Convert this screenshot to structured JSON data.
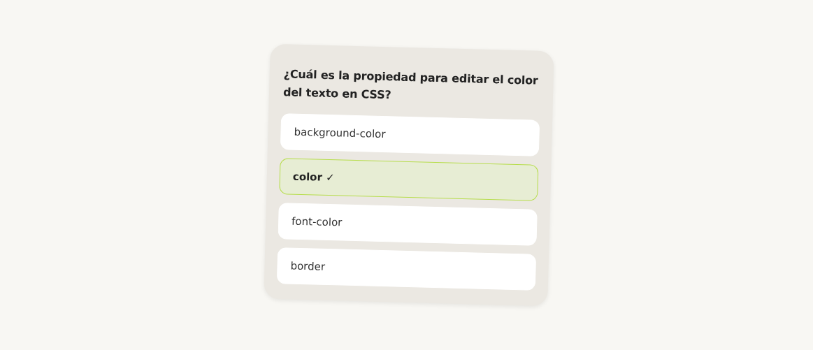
{
  "question": "¿Cuál es la propiedad para editar el color del texto en CSS?",
  "options": [
    {
      "label": "background-color",
      "selected": false
    },
    {
      "label": "color ✓",
      "selected": true
    },
    {
      "label": "font-color",
      "selected": false
    },
    {
      "label": "border",
      "selected": false
    }
  ]
}
